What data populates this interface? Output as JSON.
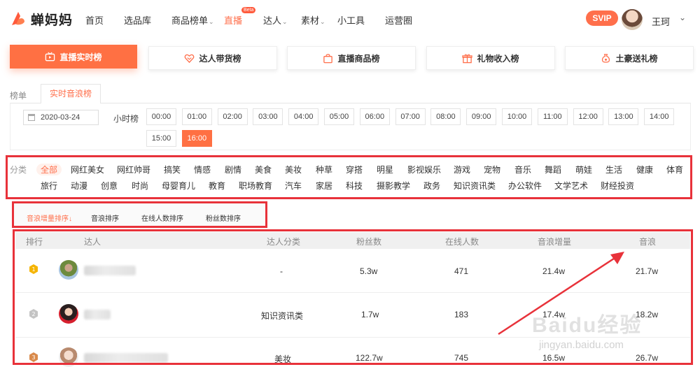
{
  "app": {
    "name": "蝉妈妈",
    "brand_color": "#ff6f4b"
  },
  "nav": {
    "items": [
      {
        "label": "首页",
        "caret": false
      },
      {
        "label": "选品库",
        "caret": false
      },
      {
        "label": "商品榜单",
        "caret": true
      },
      {
        "label": "直播",
        "caret": false,
        "active": true,
        "badge": "Beta"
      },
      {
        "label": "达人",
        "caret": true
      },
      {
        "label": "素材",
        "caret": true
      },
      {
        "label": "小工具",
        "caret": false
      },
      {
        "label": "运营圈",
        "caret": false
      }
    ],
    "svip": "SVIP",
    "username": "王珂",
    "chevron": "⌄"
  },
  "big_tabs": [
    {
      "label": "直播实时榜",
      "icon": "live-tv-icon",
      "active": true
    },
    {
      "label": "达人带货榜",
      "icon": "heart-tag-icon"
    },
    {
      "label": "直播商品榜",
      "icon": "bag-icon"
    },
    {
      "label": "礼物收入榜",
      "icon": "gift-icon"
    },
    {
      "label": "土豪送礼榜",
      "icon": "money-bag-icon"
    }
  ],
  "sub_tabs": {
    "left": "榜单",
    "active": "实时音浪榜"
  },
  "filters": {
    "date": "2020-03-24",
    "hour_label": "小时榜",
    "hours": [
      "00:00",
      "01:00",
      "02:00",
      "03:00",
      "04:00",
      "05:00",
      "06:00",
      "07:00",
      "08:00",
      "09:00",
      "10:00",
      "11:00",
      "12:00",
      "13:00",
      "14:00",
      "15:00",
      "16:00"
    ],
    "active_hour": "16:00"
  },
  "categories": {
    "label": "分类",
    "row1": [
      "全部",
      "网红美女",
      "网红帅哥",
      "搞笑",
      "情感",
      "剧情",
      "美食",
      "美妆",
      "种草",
      "穿搭",
      "明星",
      "影视娱乐",
      "游戏",
      "宠物",
      "音乐",
      "舞蹈",
      "萌娃",
      "生活",
      "健康",
      "体育"
    ],
    "row2": [
      "旅行",
      "动漫",
      "创意",
      "时尚",
      "母婴育儿",
      "教育",
      "职场教育",
      "汽车",
      "家居",
      "科技",
      "摄影教学",
      "政务",
      "知识资讯类",
      "办公软件",
      "文学艺术",
      "财经投资"
    ],
    "active": "全部"
  },
  "sort_tabs": [
    {
      "label": "音浪增量排序",
      "active": true,
      "suffix": "↓"
    },
    {
      "label": "音浪排序"
    },
    {
      "label": "在线人数排序"
    },
    {
      "label": "粉丝数排序"
    }
  ],
  "table": {
    "headers": [
      "排行",
      "达人",
      "达人分类",
      "粉丝数",
      "在线人数",
      "音浪增量",
      "音浪"
    ],
    "rows": [
      {
        "rank": "1",
        "category": "-",
        "fans": "5.3w",
        "online": "471",
        "increase": "21.4w",
        "total": "21.7w"
      },
      {
        "rank": "2",
        "category": "知识资讯类",
        "fans": "1.7w",
        "online": "183",
        "increase": "17.4w",
        "total": "18.2w"
      },
      {
        "rank": "3",
        "category": "美妆",
        "fans": "122.7w",
        "online": "745",
        "increase": "16.5w",
        "total": "26.7w"
      }
    ]
  },
  "watermark": {
    "main": "Baidu经验",
    "sub": "jingyan.baidu.com"
  }
}
